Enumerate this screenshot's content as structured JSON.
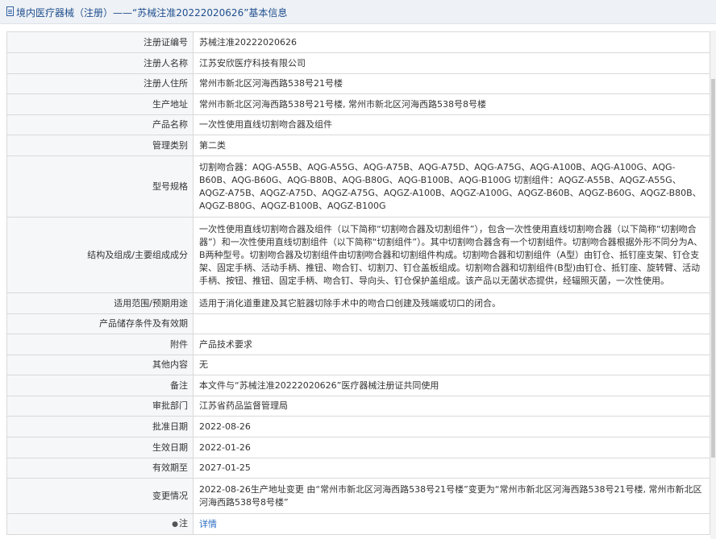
{
  "header": {
    "title": "境内医疗器械（注册）——“苏械注准20222020626”基本信息",
    "icon": "document-icon"
  },
  "rows": [
    {
      "name": "reg-no",
      "key": "注册证编号",
      "value": "苏械注准20222020626"
    },
    {
      "name": "registrant-name",
      "key": "注册人名称",
      "value": "江苏安欣医疗科技有限公司"
    },
    {
      "name": "registrant-address",
      "key": "注册人住所",
      "value": "常州市新北区河海西路538号21号楼"
    },
    {
      "name": "production-address",
      "key": "生产地址",
      "value": "常州市新北区河海西路538号21号楼, 常州市新北区河海西路538号8号楼"
    },
    {
      "name": "product-name",
      "key": "产品名称",
      "value": "一次性使用直线切割吻合器及组件"
    },
    {
      "name": "management-class",
      "key": "管理类别",
      "value": "第二类"
    },
    {
      "name": "model-spec",
      "key": "型号规格",
      "value": "切割吻合器：AQG-A55B、AQG-A55G、AQG-A75B、AQG-A75D、AQG-A75G、AQG-A100B、AQG-A100G、AQG-B60B、AQG-B60G、AQG-B80B、AQG-B80G、AQG-B100B、AQG-B100G 切割组件：AQGZ-A55B、AQGZ-A55G、AQGZ-A75B、AQGZ-A75D、AQGZ-A75G、AQGZ-A100B、AQGZ-A100G、AQGZ-B60B、AQGZ-B60G、AQGZ-B80B、AQGZ-B80G、AQGZ-B100B、AQGZ-B100G"
    },
    {
      "name": "structure-composition",
      "key": "结构及组成/主要组成成分",
      "value": "一次性使用直线切割吻合器及组件（以下简称“切割吻合器及切割组件”），包含一次性使用直线切割吻合器（以下简称“切割吻合器”）和一次性使用直线切割组件（以下简称“切割组件”）。其中切割吻合器含有一个切割组件。切割吻合器根据外形不同分为A、B两种型号。切割吻合器及切割组件由切割吻合器和切割组件构成。切割吻合器和切割组件（A型）由钉仓、抵钉座支架、钉仓支架、固定手柄、活动手柄、推钮、吻合钉、切割刀、钉仓盖板组成。切割吻合器和切割组件(B型)由钉仓、抵钉座、旋转臂、活动手柄、按钮、推钮、固定手柄、吻合钉、导向头、钉仓保护盖组成。该产品以无菌状态提供，经辐照灭菌，一次性使用。"
    },
    {
      "name": "intended-use",
      "key": "适用范围/预期用途",
      "value": "适用于消化道重建及其它脏器切除手术中的吻合口创建及残端或切口的闭合。"
    },
    {
      "name": "storage-conditions",
      "key": "产品储存条件及有效期",
      "value": ""
    },
    {
      "name": "attachment",
      "key": "附件",
      "value": "产品技术要求"
    },
    {
      "name": "other-content",
      "key": "其他内容",
      "value": "无"
    },
    {
      "name": "remarks",
      "key": "备注",
      "value": "本文件与“苏械注准20222020626”医疗器械注册证共同使用"
    },
    {
      "name": "approval-dept",
      "key": "审批部门",
      "value": "江苏省药品监督管理局"
    },
    {
      "name": "approval-date",
      "key": "批准日期",
      "value": "2022-08-26"
    },
    {
      "name": "effective-date",
      "key": "生效日期",
      "value": "2022-01-26"
    },
    {
      "name": "expiry-date",
      "key": "有效期至",
      "value": "2027-01-25"
    },
    {
      "name": "change-history",
      "key": "变更情况",
      "value": "2022-08-26生产地址变更 由“常州市新北区河海西路538号21号楼”变更为“常州市新北区河海西路538号21号楼, 常州市新北区河海西路538号8号楼”"
    }
  ],
  "note": {
    "key": "注",
    "icon": "pin-icon",
    "link": "详情"
  },
  "colors": {
    "link": "#2a6cc2",
    "title": "#1f4f8f",
    "label_bg": "#f6f7f9",
    "border": "#d9d9d9"
  }
}
